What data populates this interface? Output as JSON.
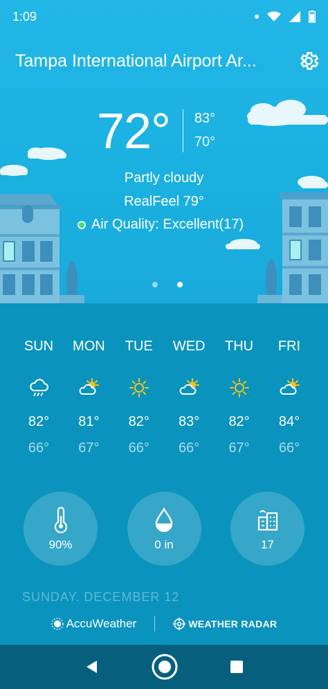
{
  "status": {
    "time": "1:09"
  },
  "header": {
    "location": "Tampa International Airport Ar..."
  },
  "current": {
    "temp": "72°",
    "high": "83°",
    "low": "70°",
    "condition": "Partly cloudy",
    "realfeel": "RealFeel 79°",
    "air_quality": "Air Quality: Excellent(17)"
  },
  "pager": {
    "pages": 2,
    "active_index": 1
  },
  "forecast": [
    {
      "day": "SUN",
      "icon": "rain-cloud-icon",
      "high": "82°",
      "low": "66°"
    },
    {
      "day": "MON",
      "icon": "partly-sunny-icon",
      "high": "81°",
      "low": "67°"
    },
    {
      "day": "TUE",
      "icon": "sun-icon",
      "high": "82°",
      "low": "66°"
    },
    {
      "day": "WED",
      "icon": "partly-sunny-icon",
      "high": "83°",
      "low": "66°"
    },
    {
      "day": "THU",
      "icon": "sun-icon",
      "high": "82°",
      "low": "67°"
    },
    {
      "day": "FRI",
      "icon": "partly-sunny-icon",
      "high": "84°",
      "low": "66°"
    }
  ],
  "details": [
    {
      "icon": "humidity-thermometer-icon",
      "value": "90%"
    },
    {
      "icon": "precipitation-drop-icon",
      "value": "0 in"
    },
    {
      "icon": "air-quality-building-icon",
      "value": "17"
    }
  ],
  "date_header": "SUNDAY, DECEMBER 12",
  "footer": {
    "brand": "AccuWeather",
    "radar": "WEATHER RADAR"
  },
  "colors": {
    "sky": "#1ab0e0",
    "body": "#0a93bd",
    "navbar": "#06607d",
    "sun": "#f5c518",
    "aq_dot": "#4fd67a"
  }
}
